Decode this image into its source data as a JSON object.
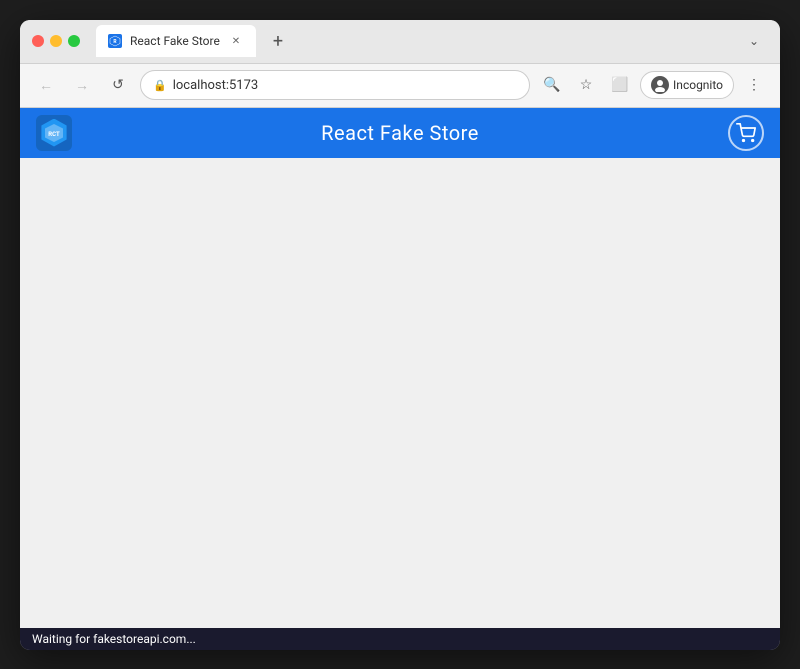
{
  "browser": {
    "tab": {
      "title": "React Fake Store",
      "favicon_text": "R"
    },
    "address": "localhost:5173",
    "incognito_label": "Incognito",
    "new_tab_symbol": "+",
    "chevron_symbol": "⌄"
  },
  "app": {
    "title": "React Fake Store",
    "logo_text": "RCT",
    "cart_icon": "🛒"
  },
  "status_bar": {
    "text": "Waiting for fakestoreapi.com..."
  },
  "nav": {
    "back": "←",
    "forward": "→",
    "refresh": "↺",
    "search_icon": "🔍",
    "bookmark_icon": "☆",
    "extensions_icon": "⬜",
    "more_icon": "⋮"
  }
}
